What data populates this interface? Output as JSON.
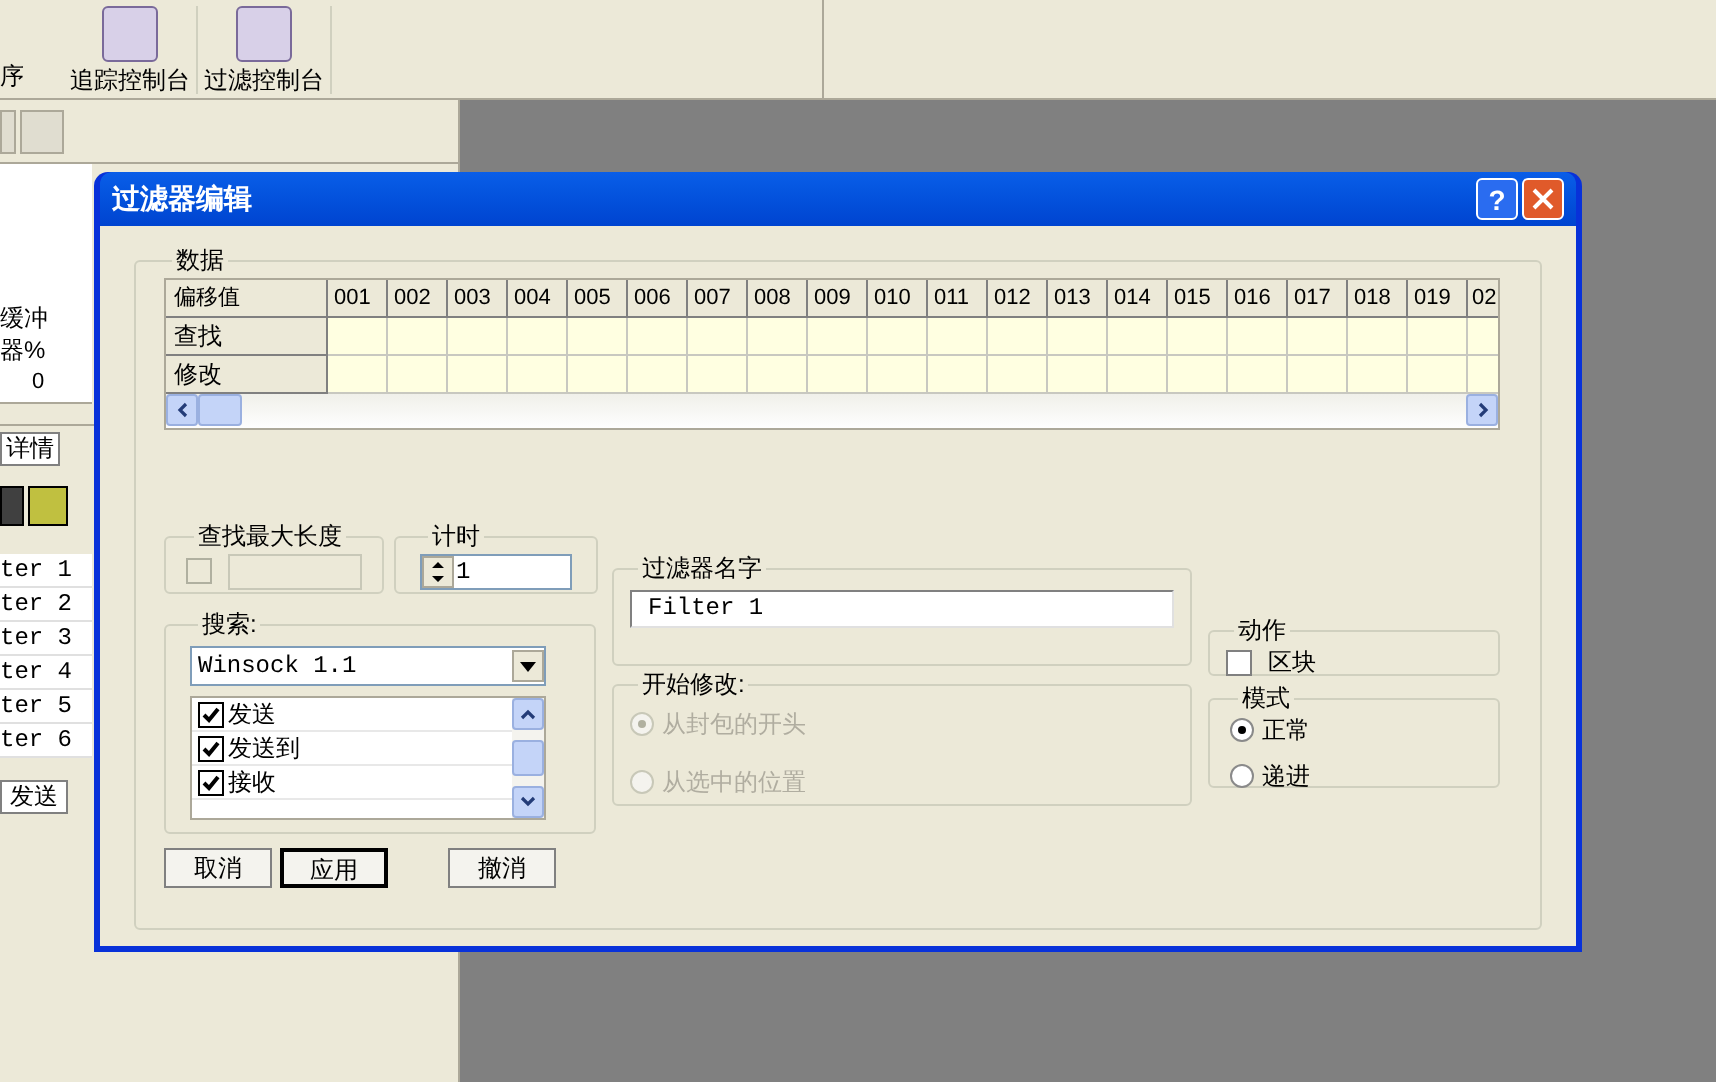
{
  "background": {
    "toolbar_text": "序",
    "toolbar_buttons": [
      {
        "label": "追踪控制台"
      },
      {
        "label": "过滤控制台"
      }
    ],
    "gauge_label": "缓冲器%",
    "gauge_value": "0",
    "tab": "详情",
    "filter_list": [
      "ter 1",
      "ter 2",
      "ter 3",
      "ter 4",
      "ter 5",
      "ter 6"
    ],
    "bottom_tab": "发送"
  },
  "dialog": {
    "title": "过滤器编辑",
    "help_button": "?",
    "data_group": {
      "label": "数据",
      "columns": [
        "偏移值",
        "001",
        "002",
        "003",
        "004",
        "005",
        "006",
        "007",
        "008",
        "009",
        "010",
        "011",
        "012",
        "013",
        "014",
        "015",
        "016",
        "017",
        "018",
        "019",
        "02"
      ],
      "rows": [
        {
          "label": "查找"
        },
        {
          "label": "修改"
        }
      ]
    },
    "max_length_group": {
      "label": "查找最大长度",
      "checked": false,
      "disabled": true
    },
    "timer_group": {
      "label": "计时",
      "value": "1"
    },
    "search_group": {
      "label": "搜索:",
      "dropdown": "Winsock 1.1",
      "items": [
        {
          "label": "发送",
          "checked": true
        },
        {
          "label": "发送到",
          "checked": true
        },
        {
          "label": "接收",
          "checked": true
        }
      ]
    },
    "buttons": [
      {
        "label": "取消",
        "default": false
      },
      {
        "label": "应用",
        "default": true
      },
      {
        "label": "撤消",
        "default": false
      }
    ],
    "name_group": {
      "label": "过滤器名字",
      "value": "Filter 1"
    },
    "modify_group": {
      "label": "开始修改:",
      "disabled": true,
      "options": [
        {
          "label": "从封包的开头",
          "selected": true
        },
        {
          "label": "从选中的位置",
          "selected": false
        }
      ]
    },
    "action_group": {
      "label": "动作",
      "option": {
        "label": "区块",
        "checked": false
      }
    },
    "mode_group": {
      "label": "模式",
      "options": [
        {
          "label": "正常",
          "selected": true
        },
        {
          "label": "递进",
          "selected": false
        }
      ]
    }
  }
}
